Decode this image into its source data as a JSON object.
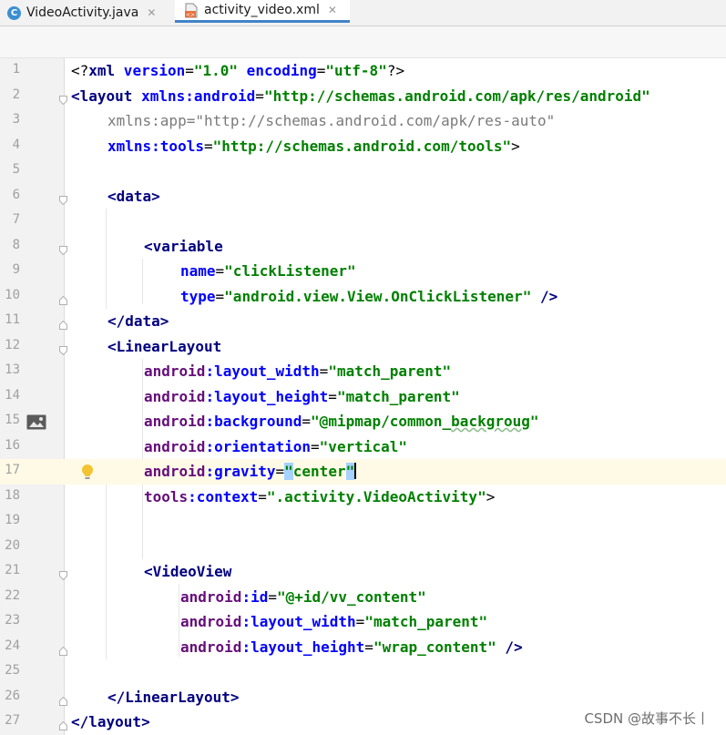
{
  "tabs": [
    {
      "label": "VideoActivity.java",
      "icon": "java-class-icon",
      "active": false
    },
    {
      "label": "activity_video.xml",
      "icon": "xml-file-icon",
      "active": true
    }
  ],
  "lines": [
    {
      "n": "1"
    },
    {
      "n": "2"
    },
    {
      "n": "3"
    },
    {
      "n": "4"
    },
    {
      "n": "5"
    },
    {
      "n": "6"
    },
    {
      "n": "7"
    },
    {
      "n": "8"
    },
    {
      "n": "9"
    },
    {
      "n": "10"
    },
    {
      "n": "11"
    },
    {
      "n": "12"
    },
    {
      "n": "13"
    },
    {
      "n": "14"
    },
    {
      "n": "15"
    },
    {
      "n": "16"
    },
    {
      "n": "17"
    },
    {
      "n": "18"
    },
    {
      "n": "19"
    },
    {
      "n": "20"
    },
    {
      "n": "21"
    },
    {
      "n": "22"
    },
    {
      "n": "23"
    },
    {
      "n": "24"
    },
    {
      "n": "25"
    },
    {
      "n": "26"
    },
    {
      "n": "27"
    }
  ],
  "code": {
    "l1": {
      "open": "<?",
      "name": "xml",
      "a1": " version",
      "eq1": "=",
      "v1": "\"1.0\"",
      "a2": " encoding",
      "eq2": "=",
      "v2": "\"utf-8\"",
      "close": "?>"
    },
    "l2": {
      "open": "<",
      "tag": "layout",
      "ns": " xmlns:android",
      "eq": "=",
      "val": "\"http://schemas.android.com/apk/res/android\""
    },
    "l3": {
      "attr": "xmlns:app",
      "eq": "=",
      "val": "\"http://schemas.android.com/apk/res-auto\""
    },
    "l4": {
      "ns": "xmlns:tools",
      "eq": "=",
      "val": "\"http://schemas.android.com/tools\"",
      "close": ">"
    },
    "l6": {
      "text": "<data>"
    },
    "l8": {
      "text": "<variable"
    },
    "l9": {
      "attr": "name",
      "eq": "=",
      "val": "\"clickListener\""
    },
    "l10": {
      "attr": "type",
      "eq": "=",
      "val": "\"android.view.View.OnClickListener\"",
      "close": " />"
    },
    "l11": {
      "text": "</data>"
    },
    "l12": {
      "text": "<LinearLayout"
    },
    "l13": {
      "ns": "android",
      "attr": ":layout_width",
      "eq": "=",
      "val": "\"match_parent\""
    },
    "l14": {
      "ns": "android",
      "attr": ":layout_height",
      "eq": "=",
      "val": "\"match_parent\""
    },
    "l15": {
      "ns": "android",
      "attr": ":background",
      "eq": "=",
      "val1": "\"@mipmap/common_",
      "val2": "backgroug",
      "val3": "\""
    },
    "l16": {
      "ns": "android",
      "attr": ":orientation",
      "eq": "=",
      "val": "\"vertical\""
    },
    "l17": {
      "ns": "android",
      "attr": ":gravity",
      "eq": "=",
      "q1": "\"",
      "val": "center",
      "q2": "\""
    },
    "l18": {
      "ns": "tools",
      "attr": ":context",
      "eq": "=",
      "val": "\".activity.VideoActivity\"",
      "close": ">"
    },
    "l21": {
      "text": "<VideoView"
    },
    "l22": {
      "ns": "android",
      "attr": ":id",
      "eq": "=",
      "val": "\"@+id/vv_content\""
    },
    "l23": {
      "ns": "android",
      "attr": ":layout_width",
      "eq": "=",
      "val": "\"match_parent\""
    },
    "l24": {
      "ns": "android",
      "attr": ":layout_height",
      "eq": "=",
      "val": "\"wrap_content\"",
      "close": " />"
    },
    "l26": {
      "text": "</LinearLayout>"
    },
    "l27": {
      "text": "</layout>"
    }
  },
  "watermark": "CSDN @故事不长丨",
  "colors": {
    "tag": "#000080",
    "attr": "#0000ff",
    "namespace": "#660e7a",
    "value": "#008000",
    "current_line": "#fefae6"
  }
}
